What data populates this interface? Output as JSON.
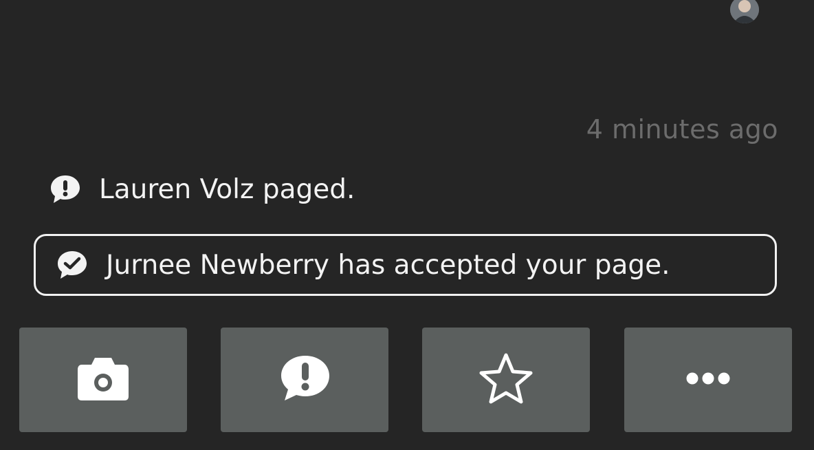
{
  "user": {
    "avatar_icon": "user-avatar"
  },
  "timeline": {
    "timestamp": "4 minutes ago",
    "events": [
      {
        "icon": "page-alert-icon",
        "text": "Lauren Volz paged."
      },
      {
        "icon": "page-accepted-icon",
        "text": "Jurnee Newberry has accepted your page."
      }
    ]
  },
  "actions": [
    {
      "icon": "camera-icon"
    },
    {
      "icon": "page-icon"
    },
    {
      "icon": "star-icon"
    },
    {
      "icon": "more-icon"
    }
  ],
  "colors": {
    "background": "#252525",
    "button": "#5b5f5e",
    "timestamp": "#6c6c6c",
    "text": "#f3f3f3",
    "border": "#f2f2f2"
  }
}
